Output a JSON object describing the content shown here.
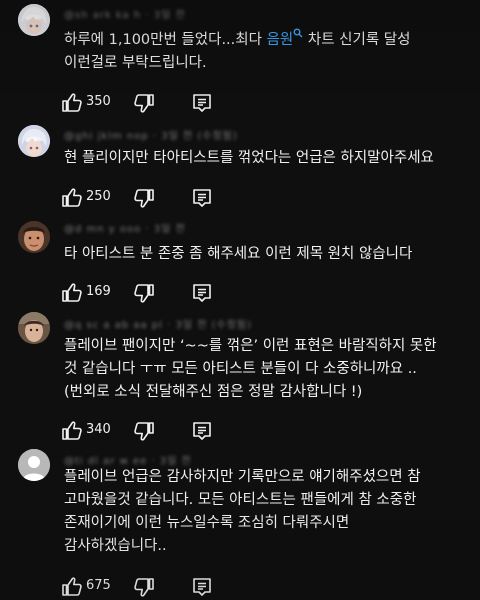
{
  "comments": [
    {
      "meta": "@sh ark ka h ·  3일 전",
      "text_before": "하루에 1,100만번 들었다...최다 ",
      "link": "음원",
      "text_after": " 차트 신기록 달성\n이런걸로 부탁드립니다.",
      "likes": "350",
      "avatar": "anime-avatar-white-hair"
    },
    {
      "meta": "@ghi jklm nop · 3일 전 (수정됨)",
      "text": "현 플리이지만 타아티스트를 꺾었다는 언급은 하지말아주세요",
      "likes": "250",
      "avatar": "anime-avatar-silver-hair"
    },
    {
      "meta": "@d mn y ooo · 3일 전",
      "text": "타 아티스트 분 존중 좀 해주세요 이런 제목 원치 않습니다",
      "likes": "169",
      "avatar": "photo-avatar-face"
    },
    {
      "meta": "@q sc a ab aa pl · 3일 전 (수정됨)",
      "text": "플레이브 팬이지만 ‘~~를 꺾은’ 이런 표현은 바람직하지 못한\n것 같습니다 ㅜㅠ 모든 아티스트 분들이 다 소중하니까요 ..\n(번외로 소식 전달해주신 점은 정말 감사합니다 !)",
      "likes": "340",
      "avatar": "photo-avatar-person"
    },
    {
      "meta": "@ti dl ar w ee · 3일 전",
      "text": "플레이브 언급은 감사하지만 기록만으로 얘기해주셨으면 참\n고마웠을것 같습니다. 모든 아티스트는 팬들에게 참 소중한\n존재이기에 이런 뉴스일수록 조심히 다뤄주시면\n감사하겠습니다..",
      "likes": "675",
      "avatar": "default-avatar"
    }
  ],
  "icons": {
    "like": "thumbs-up-icon",
    "dislike": "thumbs-down-icon",
    "reply": "comment-reply-icon",
    "search": "search-icon"
  },
  "colors": {
    "background": "#0f0f0f",
    "text": "#f1f1f1",
    "link": "#3ea6ff",
    "meta": "#7a7a7a"
  }
}
